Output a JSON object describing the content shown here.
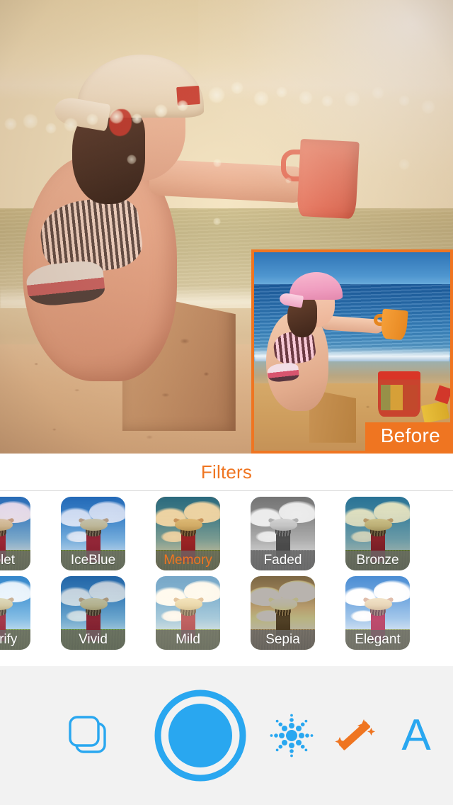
{
  "app": {
    "accent_orange": "#ef7521",
    "accent_blue": "#29a7f0",
    "toolbar_bg": "#f2f2f2"
  },
  "preview": {
    "before_label": "Before",
    "border_color": "#ef7521",
    "description": "Original unfiltered beach photo of a girl in a pink cap pouring sand from an orange cup beside a red bucket"
  },
  "photo": {
    "description": "Beach photo with warm Memory filter applied: girl building a sandcastle, holding a cup, bokeh light flares along the horizon",
    "active_filter": "Memory"
  },
  "filters": {
    "title": "Filters",
    "selected": "Memory",
    "rows": [
      [
        {
          "name": "Violet",
          "tint": "t-violet"
        },
        {
          "name": "IceBlue",
          "tint": "t-iceblue"
        },
        {
          "name": "Memory",
          "tint": "t-memory"
        },
        {
          "name": "Faded",
          "tint": "t-faded"
        },
        {
          "name": "Bronze",
          "tint": "t-bronze"
        }
      ],
      [
        {
          "name": "Clarify",
          "tint": "t-clarify"
        },
        {
          "name": "Vivid",
          "tint": "t-vivid"
        },
        {
          "name": "Mild",
          "tint": "t-mild"
        },
        {
          "name": "Sepia",
          "tint": "t-sepia"
        },
        {
          "name": "Elegant",
          "tint": "t-elegant"
        }
      ]
    ]
  },
  "toolbar": {
    "items": [
      {
        "icon": "layers-icon",
        "color": "#29a7f0"
      },
      {
        "icon": "shutter-icon",
        "color": "#29a7f0"
      },
      {
        "icon": "brightness-icon",
        "color": "#29a7f0"
      },
      {
        "icon": "magic-wand-icon",
        "color": "#ef7521"
      },
      {
        "icon": "text-icon",
        "color": "#29a7f0",
        "glyph": "A"
      }
    ],
    "text_glyph": "A"
  }
}
